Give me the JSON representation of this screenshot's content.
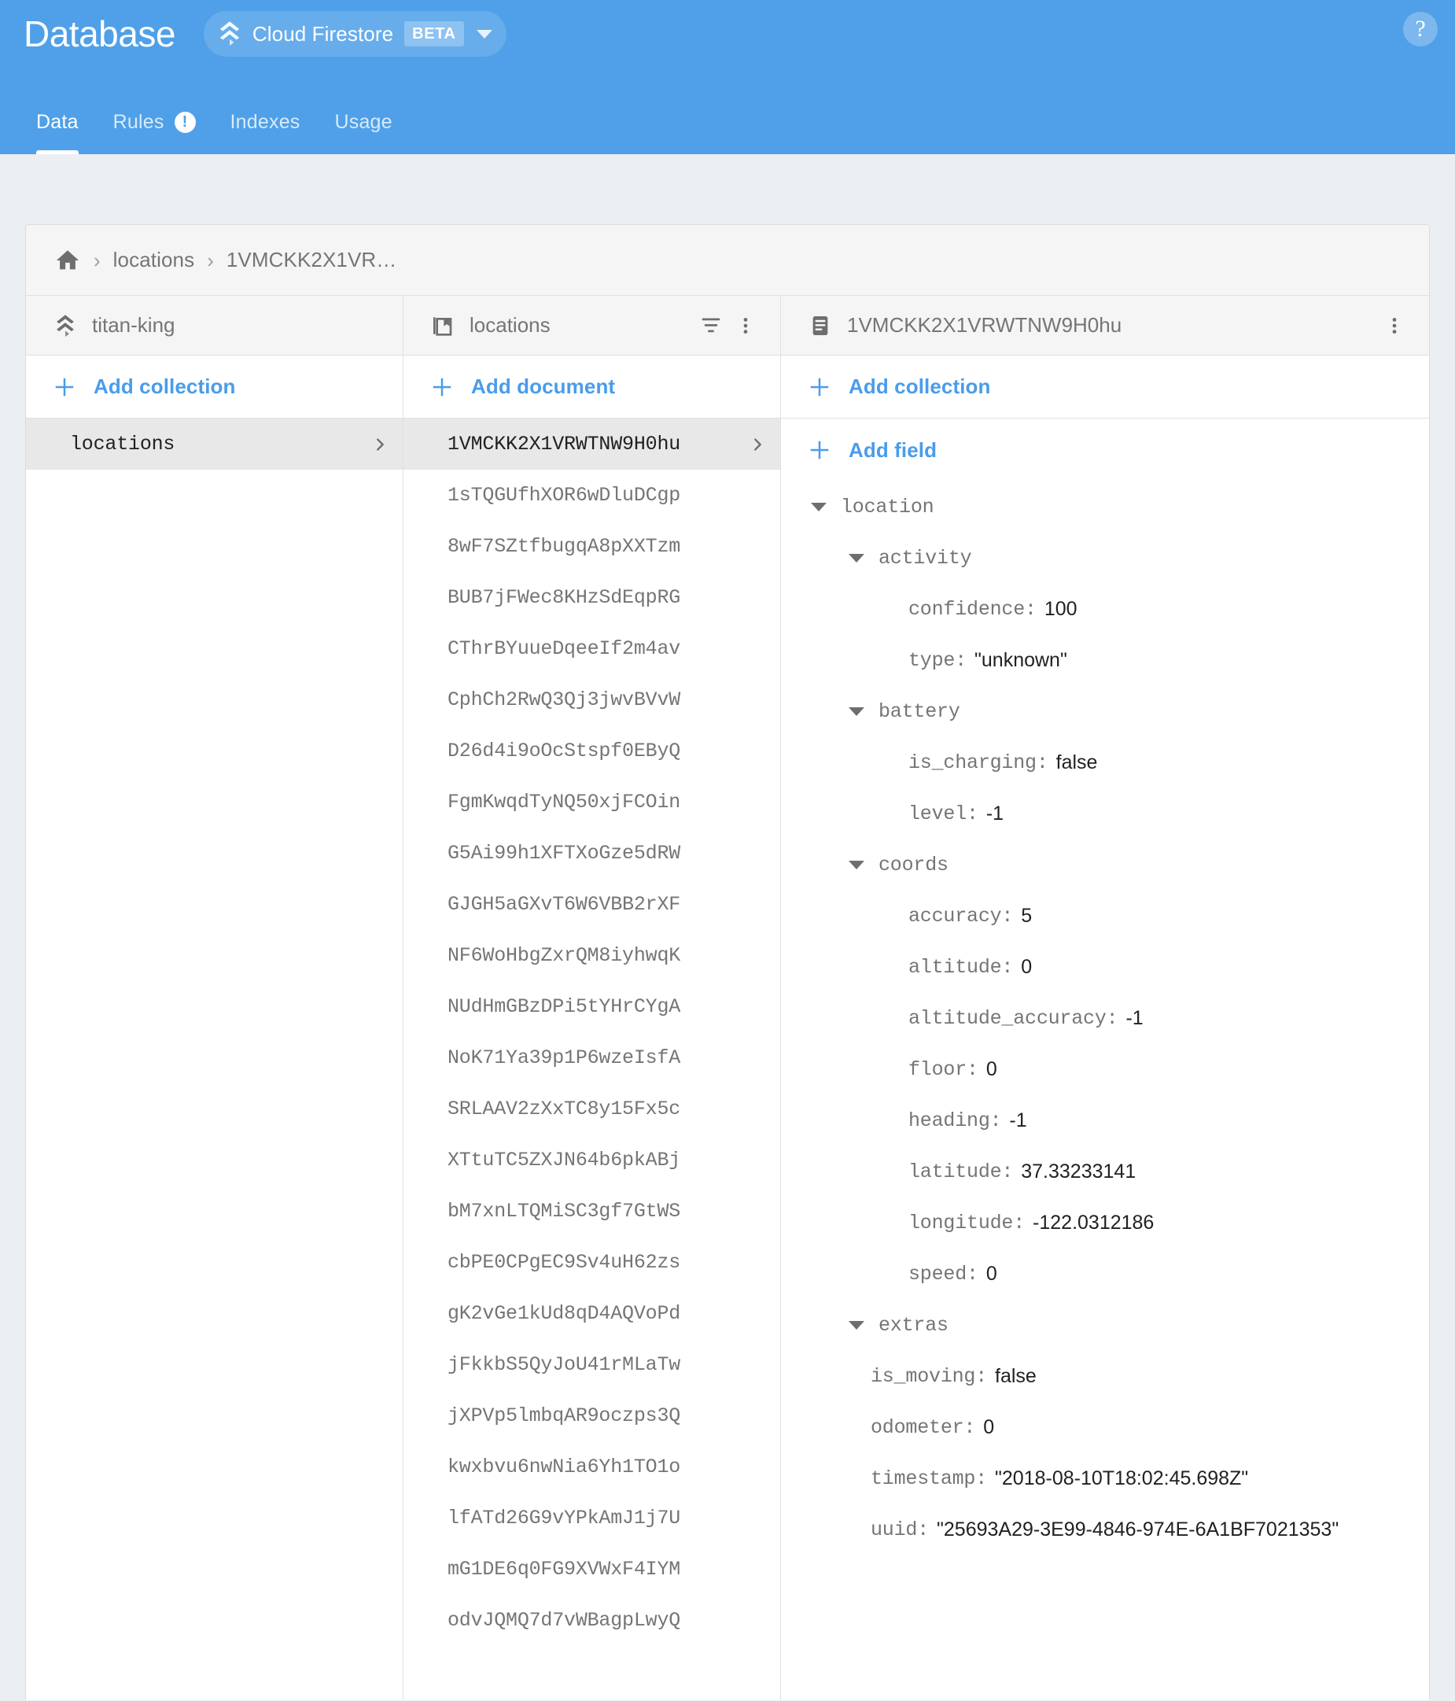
{
  "header": {
    "app_title": "Database",
    "product": {
      "name": "Cloud Firestore",
      "badge": "BETA",
      "logo_icon": "firebase-firestore-icon",
      "caret_icon": "chevron-down-icon"
    },
    "help_icon": "help-question-icon",
    "help_glyph": "?",
    "tabs": [
      {
        "label": "Data",
        "active": true,
        "warning": false
      },
      {
        "label": "Rules",
        "active": false,
        "warning": true,
        "warning_glyph": "!"
      },
      {
        "label": "Indexes",
        "active": false,
        "warning": false
      },
      {
        "label": "Usage",
        "active": false,
        "warning": false
      }
    ]
  },
  "breadcrumb": {
    "home_icon": "home-icon",
    "separator": "›",
    "items": [
      "locations",
      "1VMCKK2X1VR…"
    ]
  },
  "collections_panel": {
    "icon": "firebase-project-icon",
    "title": "titan-king",
    "add_label": "Add collection",
    "add_icon": "plus-icon",
    "items": [
      {
        "name": "locations",
        "selected": true,
        "chevron_icon": "chevron-right-icon"
      }
    ]
  },
  "documents_panel": {
    "icon": "collection-icon",
    "title": "locations",
    "filter_icon": "filter-list-icon",
    "menu_icon": "more-vert-icon",
    "add_label": "Add document",
    "add_icon": "plus-icon",
    "items": [
      {
        "id": "1VMCKK2X1VRWTNW9H0hu",
        "selected": true,
        "chevron_icon": "chevron-right-icon"
      },
      {
        "id": "1sTQGUfhXOR6wDluDCgp",
        "selected": false
      },
      {
        "id": "8wF7SZtfbugqA8pXXTzm",
        "selected": false
      },
      {
        "id": "BUB7jFWec8KHzSdEqpRG",
        "selected": false
      },
      {
        "id": "CThrBYuueDqeeIf2m4av",
        "selected": false
      },
      {
        "id": "CphCh2RwQ3Qj3jwvBVvW",
        "selected": false
      },
      {
        "id": "D26d4i9oOcStspf0EByQ",
        "selected": false
      },
      {
        "id": "FgmKwqdTyNQ50xjFCOin",
        "selected": false
      },
      {
        "id": "G5Ai99h1XFTXoGze5dRW",
        "selected": false
      },
      {
        "id": "GJGH5aGXvT6W6VBB2rXF",
        "selected": false
      },
      {
        "id": "NF6WoHbgZxrQM8iyhwqK",
        "selected": false
      },
      {
        "id": "NUdHmGBzDPi5tYHrCYgA",
        "selected": false
      },
      {
        "id": "NoK71Ya39p1P6wzeIsfA",
        "selected": false
      },
      {
        "id": "SRLAAV2zXxTC8y15Fx5c",
        "selected": false
      },
      {
        "id": "XTtuTC5ZXJN64b6pkABj",
        "selected": false
      },
      {
        "id": "bM7xnLTQMiSC3gf7GtWS",
        "selected": false
      },
      {
        "id": "cbPE0CPgEC9Sv4uH62zs",
        "selected": false
      },
      {
        "id": "gK2vGe1kUd8qD4AQVoPd",
        "selected": false
      },
      {
        "id": "jFkkbS5QyJoU41rMLaTw",
        "selected": false
      },
      {
        "id": "jXPVp5lmbqAR9oczps3Q",
        "selected": false
      },
      {
        "id": "kwxbvu6nwNia6Yh1TO1o",
        "selected": false
      },
      {
        "id": "lfATd26G9vYPkAmJ1j7U",
        "selected": false
      },
      {
        "id": "mG1DE6q0FG9XVWxF4IYM",
        "selected": false
      },
      {
        "id": "odvJQMQ7d7vWBagpLwyQ",
        "selected": false
      }
    ]
  },
  "fields_panel": {
    "icon": "document-icon",
    "title": "1VMCKK2X1VRWTNW9H0hu",
    "menu_icon": "more-vert-icon",
    "add_collection_label": "Add collection",
    "add_collection_icon": "plus-icon",
    "add_field_label": "Add field",
    "add_field_icon": "plus-icon",
    "rows": [
      {
        "depth": 0,
        "expandable": true,
        "key": "location",
        "value": ""
      },
      {
        "depth": 1,
        "expandable": true,
        "key": "activity",
        "value": ""
      },
      {
        "depth": 2,
        "expandable": false,
        "key": "confidence:",
        "value": "100"
      },
      {
        "depth": 2,
        "expandable": false,
        "key": "type:",
        "value": "\"unknown\""
      },
      {
        "depth": 1,
        "expandable": true,
        "key": "battery",
        "value": ""
      },
      {
        "depth": 2,
        "expandable": false,
        "key": "is_charging:",
        "value": "false"
      },
      {
        "depth": 2,
        "expandable": false,
        "key": "level:",
        "value": "-1"
      },
      {
        "depth": 1,
        "expandable": true,
        "key": "coords",
        "value": ""
      },
      {
        "depth": 2,
        "expandable": false,
        "key": "accuracy:",
        "value": "5"
      },
      {
        "depth": 2,
        "expandable": false,
        "key": "altitude:",
        "value": "0"
      },
      {
        "depth": 2,
        "expandable": false,
        "key": "altitude_accuracy:",
        "value": "-1"
      },
      {
        "depth": 2,
        "expandable": false,
        "key": "floor:",
        "value": "0"
      },
      {
        "depth": 2,
        "expandable": false,
        "key": "heading:",
        "value": "-1"
      },
      {
        "depth": 2,
        "expandable": false,
        "key": "latitude:",
        "value": "37.33233141"
      },
      {
        "depth": 2,
        "expandable": false,
        "key": "longitude:",
        "value": "-122.0312186"
      },
      {
        "depth": 2,
        "expandable": false,
        "key": "speed:",
        "value": "0"
      },
      {
        "depth": 1,
        "expandable": true,
        "key": "extras",
        "value": ""
      },
      {
        "depth": 1,
        "expandable": false,
        "key": "is_moving:",
        "value": "false"
      },
      {
        "depth": 1,
        "expandable": false,
        "key": "odometer:",
        "value": "0"
      },
      {
        "depth": 1,
        "expandable": false,
        "key": "timestamp:",
        "value": "\"2018-08-10T18:02:45.698Z\""
      },
      {
        "depth": 1,
        "expandable": false,
        "key": "uuid:",
        "value": "\"25693A29-3E99-4846-974E-6A1BF7021353\""
      }
    ]
  },
  "colors": {
    "brand_blue": "#4fa0e8",
    "link_blue": "#4a9cea",
    "surface": "#ffffff",
    "panel_header": "#f5f5f5",
    "selected_row": "#e8e8e8",
    "page_bg": "#eceff1",
    "text_muted": "#757575",
    "text_strong": "#212121"
  }
}
